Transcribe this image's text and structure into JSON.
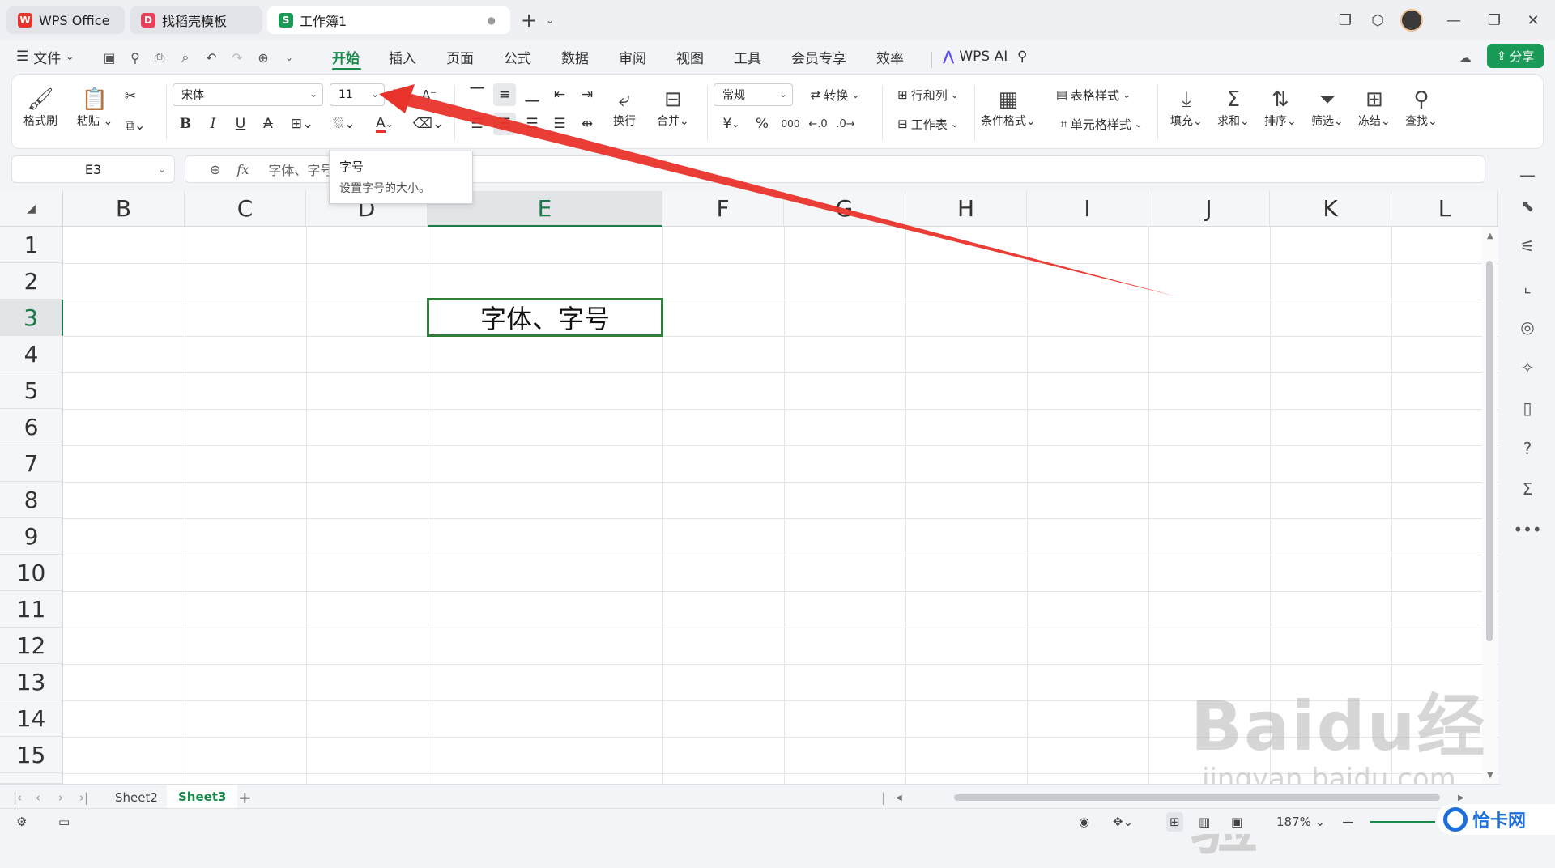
{
  "titlebar": {
    "tabs": [
      {
        "label": "WPS Office",
        "icon": "wps-logo-icon",
        "active": false
      },
      {
        "label": "找稻壳模板",
        "icon": "docer-icon",
        "active": false
      },
      {
        "label": "工作簿1",
        "icon": "spreadsheet-icon",
        "active": true
      }
    ],
    "new_tab": "+"
  },
  "menubar": {
    "file": "文件",
    "items": [
      "开始",
      "插入",
      "页面",
      "公式",
      "数据",
      "审阅",
      "视图",
      "工具",
      "会员专享",
      "效率"
    ],
    "active": "开始",
    "wps_ai": "WPS AI",
    "share": "分享"
  },
  "ribbon": {
    "format_painter": "格式刷",
    "paste": "粘贴",
    "font_name": "宋体",
    "font_size": "11",
    "wrap": "换行",
    "merge": "合并",
    "number_format": "常规",
    "convert": "转换",
    "rows_cols": "行和列",
    "worksheet": "工作表",
    "cond_format": "条件格式",
    "table_style": "表格样式",
    "cell_style": "单元格样式",
    "fill": "填充",
    "sum": "求和",
    "sort": "排序",
    "filter": "筛选",
    "freeze": "冻结",
    "find": "查找",
    "bold": "B",
    "italic": "I",
    "underline": "U",
    "strike": "A",
    "font_color": "A",
    "currency": "¥",
    "percent": "%",
    "thousands": "000"
  },
  "tooltip": {
    "title": "字号",
    "desc": "设置字号的大小。"
  },
  "formula": {
    "namebox": "E3",
    "fx": "fx",
    "content": "字体、字号"
  },
  "grid": {
    "columns": [
      "B",
      "C",
      "D",
      "E",
      "F",
      "G",
      "H",
      "I",
      "J",
      "K",
      "L"
    ],
    "selected_col": "E",
    "rows": [
      "1",
      "2",
      "3",
      "4",
      "5",
      "6",
      "7",
      "8",
      "9",
      "10",
      "11",
      "12",
      "13",
      "14",
      "15"
    ],
    "selected_row": "3",
    "selected_cell_text": "字体、字号"
  },
  "sheets": {
    "tabs": [
      "Sheet2",
      "Sheet3"
    ],
    "active": "Sheet3",
    "add": "+"
  },
  "status": {
    "zoom": "187%"
  },
  "watermark": {
    "brand": "Baidu经验",
    "url": "jingyan.baidu.com",
    "corner": "恰卡网"
  },
  "colors": {
    "accent_green": "#1a8a4c",
    "selection_border": "#2f7d3a",
    "annotation_arrow": "#e8332a"
  }
}
